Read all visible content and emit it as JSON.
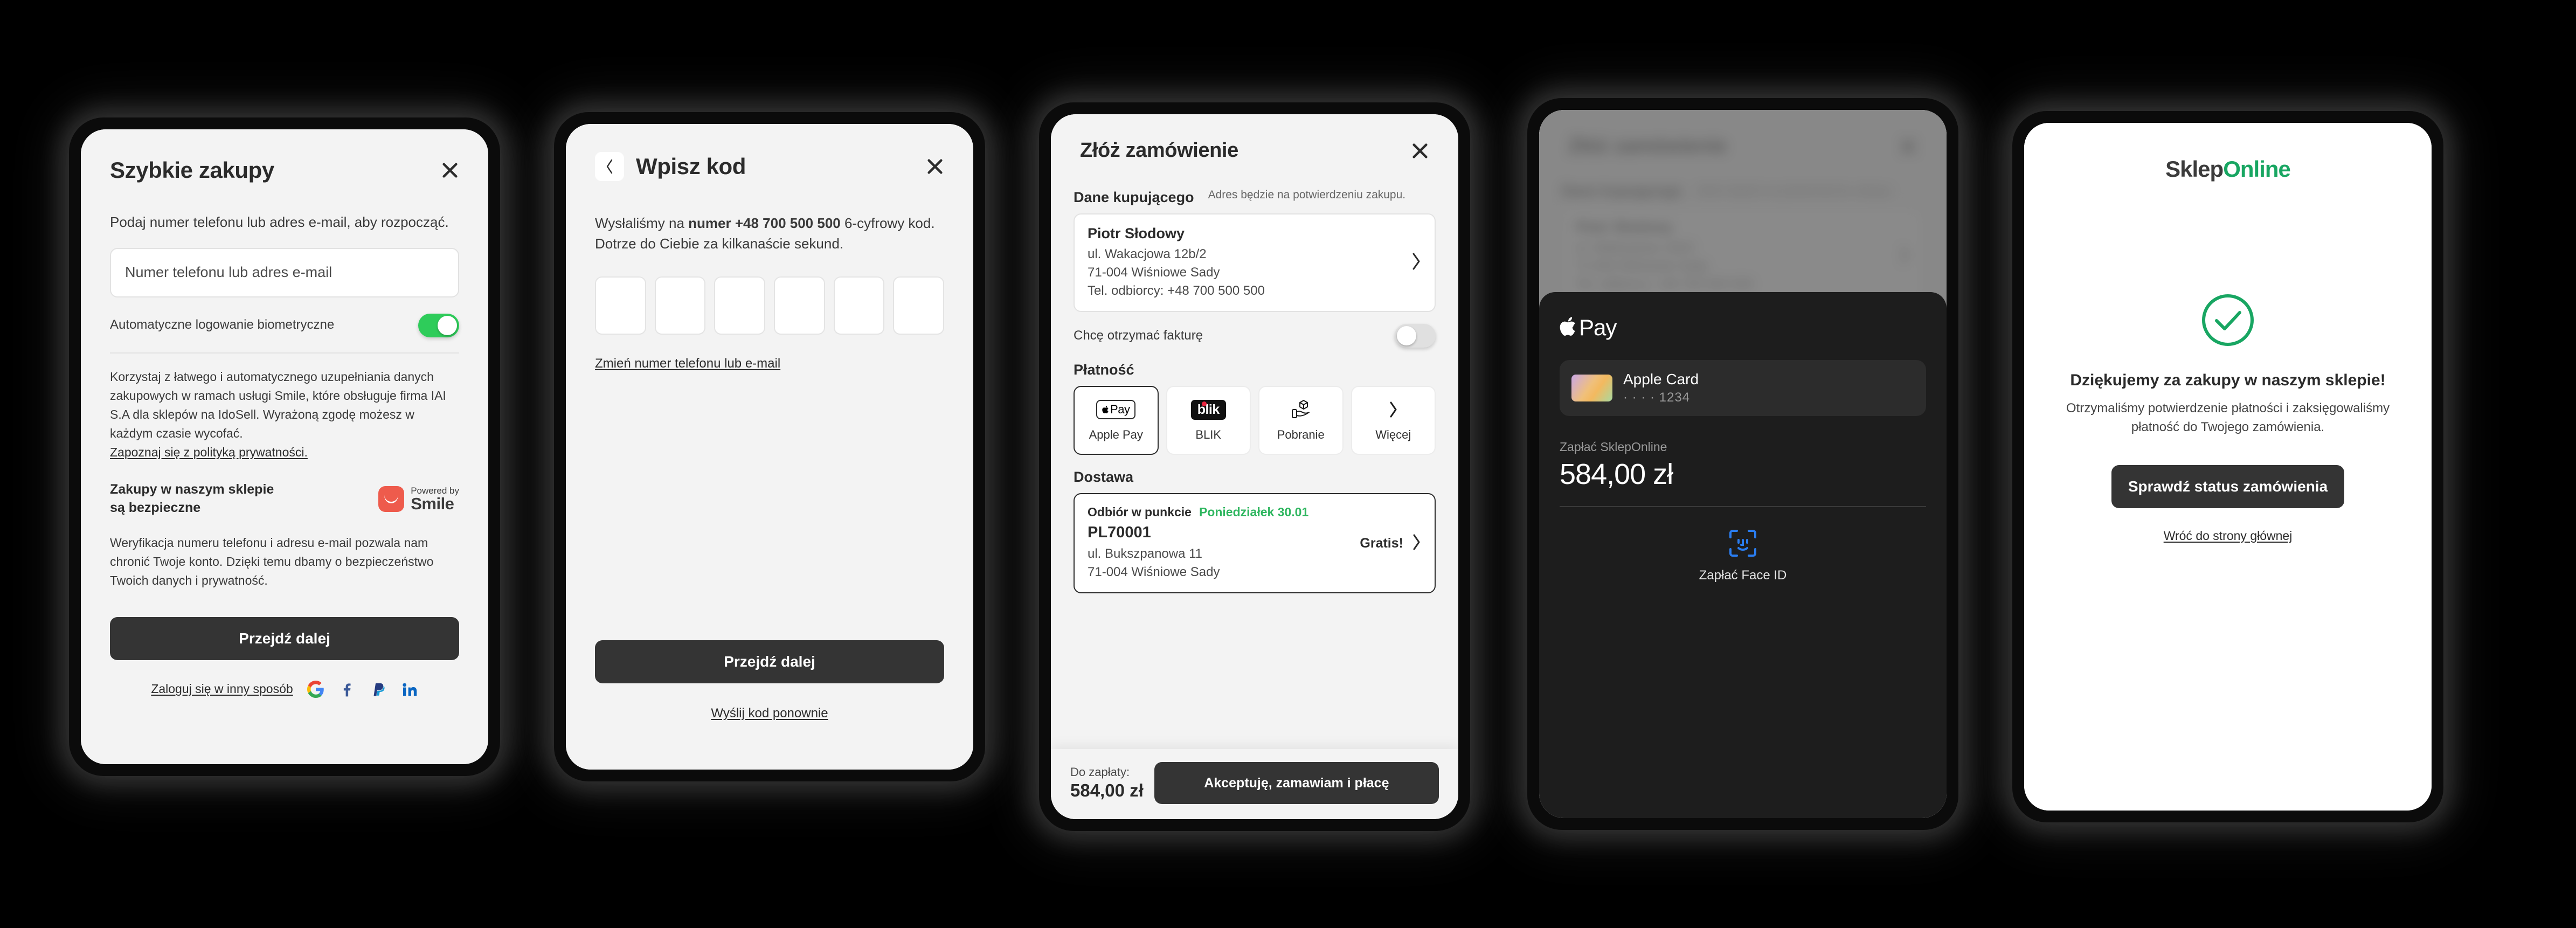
{
  "colors": {
    "toggle_on": "#2ECC5A",
    "brand_green": "#18A662",
    "accent_green": "#2EB65F",
    "smile_red": "#EE5B4C",
    "dark_button": "#343434",
    "screen_bg": "#f3f3f3",
    "faceid_blue": "#2a7df0"
  },
  "screen1": {
    "title": "Szybkie zakupy",
    "close_icon": "close-icon",
    "lead": "Podaj numer telefonu lub adres e-mail, aby rozpocząć.",
    "input_placeholder": "Numer telefonu lub adres e-mail",
    "input_value": "",
    "biometric_label": "Automatyczne logowanie biometryczne",
    "biometric_state": "on",
    "consent_text": "Korzystaj z łatwego i automatycznego uzupełniania danych zakupowych w ramach usługi Smile, które obsługuje firma IAI S.A dla sklepów na IdoSell. Wyrażoną zgodę możesz w każdym czasie wycofać.",
    "privacy_link": "Zapoznaj się z polityką prywatności.",
    "secure_title_line1": "Zakupy w naszym sklepie",
    "secure_title_line2": "są bezpieczne",
    "smile_powered_by": "Powered by",
    "smile_name": "Smile",
    "secure_body": "Weryfikacja numeru telefonu i adresu e-mail pozwala nam chronić Twoje konto. Dzięki temu dbamy o bezpieczeństwo Twoich danych i prywatność.",
    "primary_button": "Przejdź dalej",
    "alt_login_label": "Zaloguj się w inny sposób",
    "alt_login_icons": [
      "google-icon",
      "facebook-icon",
      "paypal-icon",
      "linkedin-icon"
    ]
  },
  "screen2": {
    "back_icon": "chevron-left-icon",
    "title": "Wpisz kod",
    "close_icon": "close-icon",
    "lead_prefix": "Wysłaliśmy na ",
    "lead_bold": "numer +48 700 500 500",
    "lead_suffix": " 6-cyfrowy kod.",
    "lead_line2": "Dotrze do Ciebie za kilkanaście sekund.",
    "code_digits": [
      "",
      "",
      "",
      "",
      "",
      ""
    ],
    "change_link": "Zmień numer telefonu lub e-mail",
    "primary_button": "Przejdź dalej",
    "resend_link": "Wyślij kod ponownie"
  },
  "screen3": {
    "title": "Złóż zamówienie",
    "close_icon": "close-icon",
    "buyer_section_label": "Dane kupującego",
    "buyer_note": "Adres będzie na potwierdzeniu zakupu.",
    "buyer": {
      "name": "Piotr Słodowy",
      "street": "ul. Wakacjowa 12b/2",
      "city": "71-004  Wiśniowe Sady",
      "phone": "Tel. odbiorcy: +48 700 500 500",
      "chevron": "chevron-right-icon"
    },
    "invoice_label": "Chcę otrzymać fakturę",
    "invoice_state": "off",
    "payment_section_label": "Płatność",
    "payment_methods": [
      {
        "label": "Apple Pay",
        "icon": "apple-pay-icon",
        "selected": true
      },
      {
        "label": "BLIK",
        "icon": "blik-icon",
        "selected": false
      },
      {
        "label": "Pobranie",
        "icon": "package-in-hand-icon",
        "selected": false
      },
      {
        "label": "Więcej",
        "icon": "chevron-right-icon",
        "selected": false
      }
    ],
    "delivery_section_label": "Dostawa",
    "delivery": {
      "kind": "Odbiór w punkcie",
      "date": "Poniedziałek 30.01",
      "code": "PL70001",
      "street": "ul. Bukszpanowa 11",
      "city": "71-004  Wiśniowe Sady",
      "price": "Gratis!",
      "chevron": "chevron-right-icon"
    },
    "total_label": "Do zapłaty:",
    "total_amount": "584,00 zł",
    "submit_button": "Akceptuję, zamawiam i płacę"
  },
  "screen4": {
    "logo_word": "Pay",
    "logo_icon": "apple-logo-icon",
    "card_name": "Apple Card",
    "card_number": "· · · · 1234",
    "card_art_icon": "apple-card-icon",
    "pay_to_label": "Zapłać SklepOnline",
    "amount": "584,00 zł",
    "faceid_icon": "face-id-icon",
    "faceid_label": "Zapłać Face ID"
  },
  "screen5": {
    "logo_part1": "Sklep",
    "logo_part2": "Online",
    "success_icon": "check-circle-icon",
    "heading": "Dziękujemy za zakupy w naszym sklepie!",
    "body": "Otrzymaliśmy potwierdzenie płatności i zaksięgowaliśmy płatność do Twojego zamówienia.",
    "primary_button": "Sprawdź status zamówienia",
    "home_link": "Wróć do strony głównej"
  }
}
